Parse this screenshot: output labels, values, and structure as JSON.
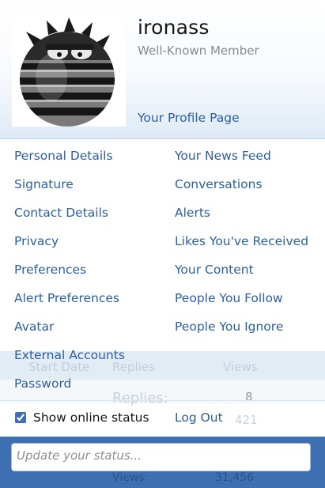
{
  "profile": {
    "username": "ironass",
    "title": "Well-Known Member",
    "profile_link": "Your Profile Page"
  },
  "menu": {
    "left": [
      "Personal Details",
      "Signature",
      "Contact Details",
      "Privacy",
      "Preferences",
      "Alert Preferences",
      "Avatar",
      "External Accounts",
      "Password"
    ],
    "right": [
      "Your News Feed",
      "Conversations",
      "Alerts",
      "Likes You've Received",
      "Your Content",
      "People You Follow",
      "People You Ignore"
    ]
  },
  "footer": {
    "online_status_label": "Show online status",
    "online_status_checked": true,
    "logout_label": "Log Out",
    "status_placeholder": "Update your status..."
  },
  "background_page": {
    "col_start_date": "Start Date",
    "col_replies": "Replies",
    "col_views": "Views",
    "row_replies_label": "Replies:",
    "row_replies_value": "8",
    "row_views_value": "421",
    "lower_views_label": "Views:",
    "lower_views_value": "31,456"
  },
  "colors": {
    "link": "#2b5fa2",
    "status_bar": "#3d6fb2",
    "header_gradient_end": "#dfeaf6"
  }
}
